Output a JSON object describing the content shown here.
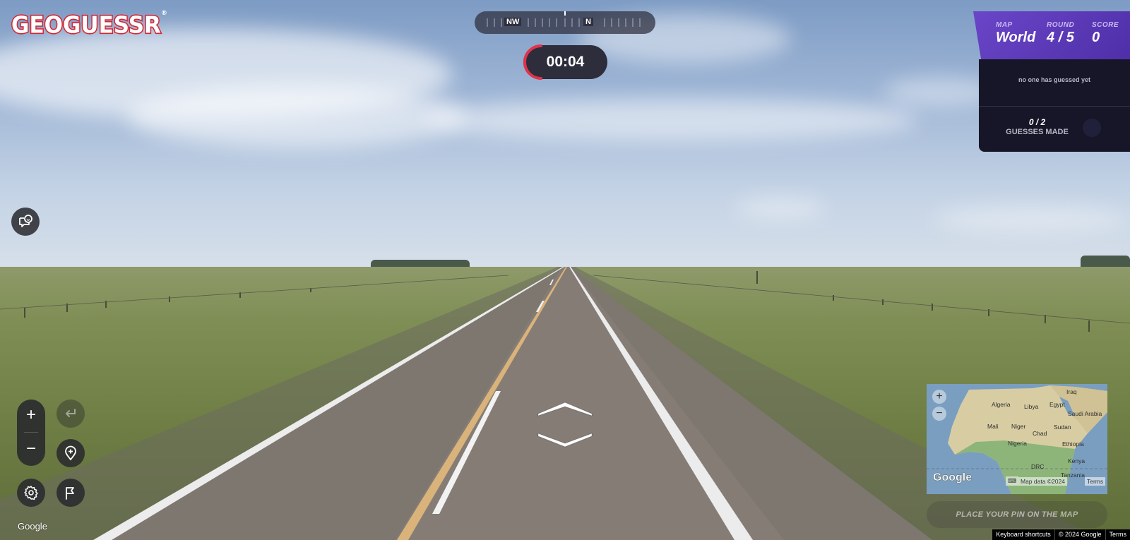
{
  "logo": {
    "text": "GEOGUESSR",
    "registered": "®"
  },
  "compass": {
    "labels": [
      "NW",
      "N"
    ]
  },
  "timer": {
    "time": "00:04",
    "accent_color": "#e0344a"
  },
  "status": {
    "map_label": "MAP",
    "map_value": "World",
    "round_label": "ROUND",
    "round_value": "4 / 5",
    "score_label": "SCORE",
    "score_value": "0"
  },
  "guess_panel": {
    "message": "no one has guessed yet",
    "count": "0 / 2",
    "label": "GUESSES MADE"
  },
  "controls": {
    "zoom_in": "+",
    "zoom_out": "−"
  },
  "minimap": {
    "countries": [
      "Iraq",
      "Algeria",
      "Libya",
      "Egypt",
      "Saudi Arabia",
      "Mali",
      "Niger",
      "Chad",
      "Sudan",
      "Nigeria",
      "Ethiopia",
      "Kenya",
      "DRC",
      "Tanzania"
    ],
    "zoom_in": "+",
    "zoom_out": "−",
    "brand": "Google",
    "map_data": "Map data ©2024",
    "terms": "Terms"
  },
  "place_pin": "PLACE YOUR PIN ON THE MAP",
  "streetview": {
    "brand": "Google"
  },
  "footer": {
    "shortcuts": "Keyboard shortcuts",
    "copyright": "© 2024 Google",
    "terms": "Terms"
  },
  "colors": {
    "brand_red": "#d92531",
    "panel_purple": "#5a37b8",
    "panel_dark": "#161628"
  }
}
